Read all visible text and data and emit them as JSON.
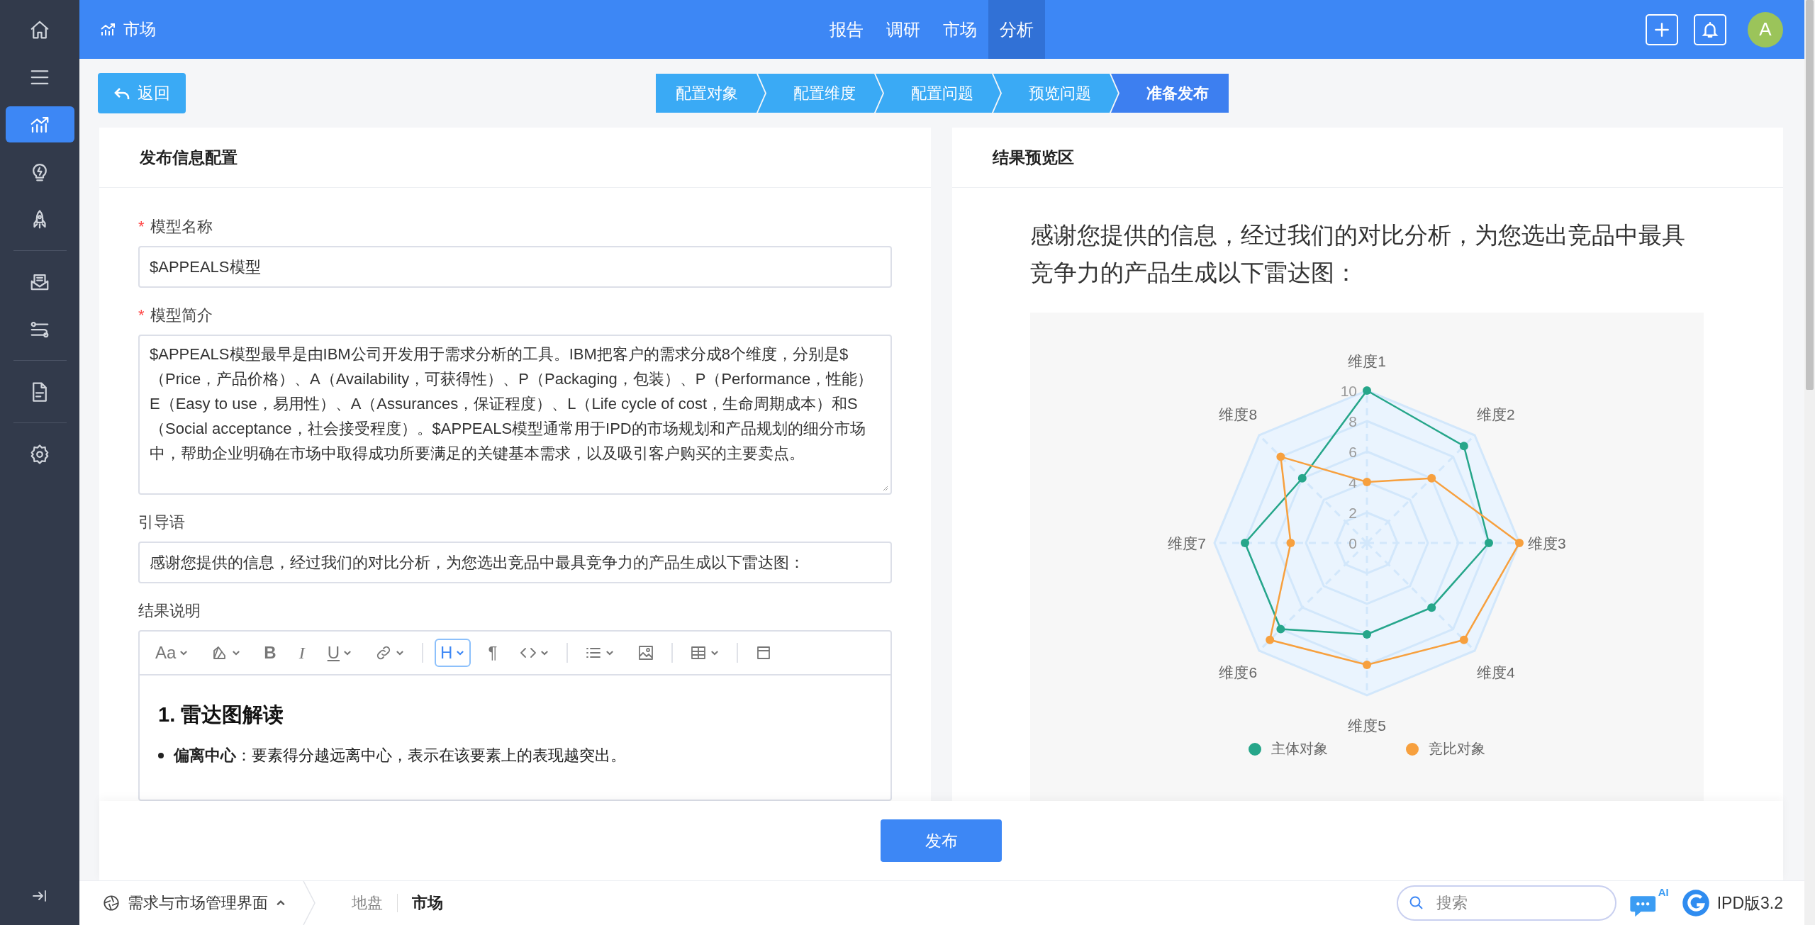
{
  "sidebar": {
    "groups": [
      [
        {
          "kind": "home",
          "selected": false
        },
        {
          "kind": "menu",
          "selected": false
        },
        {
          "kind": "chart",
          "selected": true
        },
        {
          "kind": "bulb",
          "selected": false
        },
        {
          "kind": "rocket",
          "selected": false
        }
      ],
      [
        {
          "kind": "inbox",
          "selected": false
        },
        {
          "kind": "sliders",
          "selected": false
        }
      ],
      [
        {
          "kind": "document",
          "selected": false
        }
      ],
      [
        {
          "kind": "settings",
          "selected": false
        }
      ]
    ]
  },
  "header": {
    "title": "市场",
    "tabs": [
      {
        "label": "报告",
        "selected": false
      },
      {
        "label": "调研",
        "selected": false
      },
      {
        "label": "市场",
        "selected": false
      },
      {
        "label": "分析",
        "selected": true
      }
    ],
    "avatar": "A"
  },
  "toolbar": {
    "back": "返回",
    "steps": [
      {
        "label": "配置对象",
        "selected": false
      },
      {
        "label": "配置维度",
        "selected": false
      },
      {
        "label": "配置问题",
        "selected": false
      },
      {
        "label": "预览问题",
        "selected": false
      },
      {
        "label": "准备发布",
        "selected": true
      }
    ]
  },
  "form": {
    "title": "发布信息配置",
    "fields": [
      {
        "kind": "input",
        "label": "模型名称",
        "required_mark": "*",
        "value": "$APPEALS模型"
      },
      {
        "kind": "textarea",
        "label": "模型简介",
        "required_mark": "*",
        "value": "$APPEALS模型最早是由IBM公司开发用于需求分析的工具。IBM把客户的需求分成8个维度，分别是$（Price，产品价格）、A（Availability，可获得性）、P（Packaging，包装）、P（Performance，性能）E（Easy to use，易用性）、A（Assurances，保证程度）、L（Life cycle of cost，生命周期成本）和S（Social acceptance，社会接受程度）。$APPEALS模型通常用于IPD的市场规划和产品规划的细分市场中，帮助企业明确在市场中取得成功所要满足的关键基本需求，以及吸引客户购买的主要卖点。"
      },
      {
        "kind": "input",
        "label": "引导语",
        "value": "感谢您提供的信息，经过我们的对比分析，为您选出竞品中最具竞争力的产品生成以下雷达图："
      }
    ],
    "editor": {
      "label": "结果说明",
      "tools": [
        {
          "kind": "text",
          "label": "Aa",
          "caret": true,
          "active": false
        },
        {
          "kind": "brush",
          "caret": true,
          "active": false
        },
        {
          "kind": "bold",
          "label": "B",
          "caret": false,
          "active": false
        },
        {
          "kind": "italic",
          "label": "I",
          "caret": false,
          "active": false
        },
        {
          "kind": "underline",
          "label": "U",
          "caret": true,
          "active": false
        },
        {
          "kind": "link",
          "caret": true,
          "active": false
        },
        {
          "kind": "separator"
        },
        {
          "kind": "text",
          "label": "H",
          "caret": true,
          "active": true
        },
        {
          "kind": "text",
          "label": "¶",
          "caret": false,
          "active": false
        },
        {
          "kind": "code",
          "caret": true,
          "active": false
        },
        {
          "kind": "separator"
        },
        {
          "kind": "list",
          "caret": true,
          "active": false
        },
        {
          "kind": "image",
          "caret": false,
          "active": false
        },
        {
          "kind": "separator"
        },
        {
          "kind": "table",
          "caret": true,
          "active": false
        },
        {
          "kind": "separator"
        },
        {
          "kind": "layout",
          "caret": false,
          "active": false
        }
      ],
      "heading": "1. 雷达图解读",
      "bullets": [
        "**偏离中心**：要素得分越远离中心，表示在该要素上的表现越突出。"
      ]
    }
  },
  "preview": {
    "title": "结果预览区",
    "intro": "感谢您提供的信息，经过我们的对比分析，为您选出竞品中最具竞争力的产品生成以下雷达图：",
    "chart_data": {
      "type": "radar",
      "categories": [
        "维度1",
        "维度2",
        "维度3",
        "维度4",
        "维度5",
        "维度6",
        "维度7",
        "维度8"
      ],
      "ylim": [
        0,
        10
      ],
      "legend": "bottom",
      "yticks": [
        0,
        2,
        4,
        6,
        8,
        10
      ],
      "series": [
        {
          "name": "主体对象",
          "color": "#26a68a",
          "values": [
            10,
            9,
            8,
            6,
            6,
            8,
            8,
            6
          ]
        },
        {
          "name": "竞比对象",
          "color": "#f7a03e",
          "values": [
            4,
            6,
            10,
            9,
            8,
            9,
            5,
            8
          ]
        }
      ]
    }
  },
  "footer": {
    "publish": "发布"
  },
  "status_bar": {
    "module": "需求与市场管理界面",
    "breadcrumbs": [
      {
        "label": "地盘",
        "selected": false
      },
      {
        "label": "市场",
        "selected": true
      }
    ],
    "search_placeholder": "搜索",
    "ai_badge": "AI",
    "version": "IPD版3.2"
  }
}
